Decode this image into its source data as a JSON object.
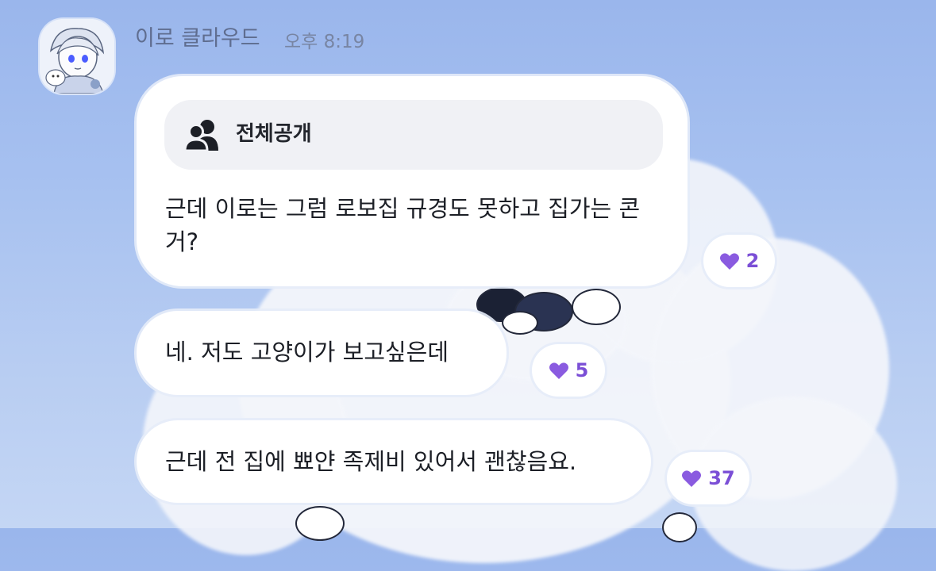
{
  "chat": {
    "sender_name": "이로 클라우드",
    "time": "오후 8:19"
  },
  "messages": [
    {
      "visibility_label": "전체공개",
      "text": "근데 이로는 그럼 로보집 규경도 못하고 집가는 콘거?",
      "reaction_count": "2"
    },
    {
      "text": "네. 저도 고양이가 보고싶은데",
      "reaction_count": "5"
    },
    {
      "text": "근데 전 집에 뾰얀 족제비 있어서 괜찮음요.",
      "reaction_count": "37"
    }
  ],
  "colors": {
    "accent": "#8a5be0",
    "bubble": "#ffffff",
    "sky": "#a7c1f0"
  },
  "icons": {
    "visibility": "people-icon",
    "reaction": "heart-icon"
  }
}
